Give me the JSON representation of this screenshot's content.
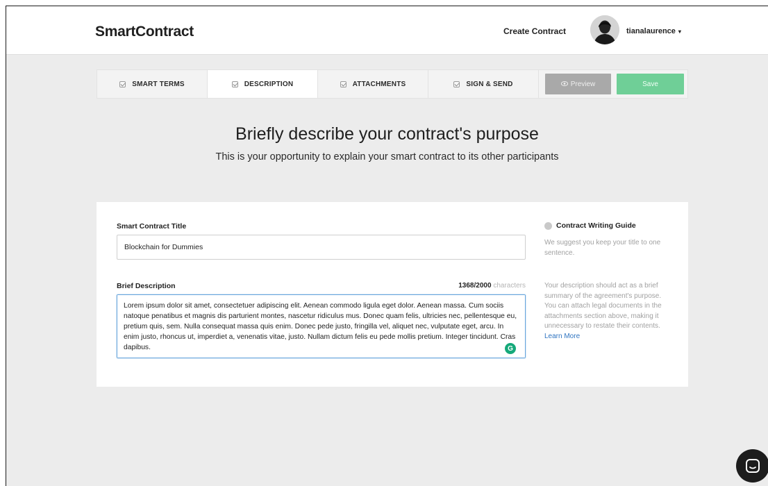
{
  "app": {
    "brand": "SmartContract",
    "create_contract": "Create Contract",
    "username": "tianalaurence",
    "caret": "▾"
  },
  "tabs": [
    {
      "label": "SMART TERMS",
      "active": false
    },
    {
      "label": "DESCRIPTION",
      "active": true
    },
    {
      "label": "ATTACHMENTS",
      "active": false
    },
    {
      "label": "SIGN & SEND",
      "active": false
    }
  ],
  "actions": {
    "preview_label": "Preview",
    "save_label": "Save"
  },
  "page": {
    "heading": "Briefly describe your contract's purpose",
    "subheading": "This is your opportunity to explain your smart contract to its other participants"
  },
  "form": {
    "title_label": "Smart Contract Title",
    "title_value": "Blockchain for Dummies",
    "description_label": "Brief Description",
    "char_count": "1368",
    "char_limit": "/2000",
    "char_suffix": "characters",
    "description_value": "Lorem ipsum dolor sit amet, consectetuer adipiscing elit. Aenean commodo ligula eget dolor. Aenean massa. Cum sociis natoque penatibus et magnis dis parturient montes, nascetur ridiculus mus. Donec quam felis, ultricies nec, pellentesque eu, pretium quis, sem. Nulla consequat massa quis enim. Donec pede justo, fringilla vel, aliquet nec, vulputate eget, arcu. In enim justo, rhoncus ut, imperdiet a, venenatis vitae, justo. Nullam dictum felis eu pede mollis pretium. Integer tincidunt. Cras dapibus."
  },
  "guide": {
    "title": "Contract Writing Guide",
    "title_tip": "We suggest you keep your title to one sentence.",
    "description_tip": "Your description should act as a brief summary of the agreement's purpose. You can attach legal documents in the attachments section above, making it unnecessary to restate their contents.",
    "learn_more": "Learn More"
  },
  "icons": {
    "checkbox": "checkbox-icon",
    "eye": "eye-icon",
    "info": "info-icon",
    "grammarly": "grammarly-icon",
    "chat": "chat-icon"
  },
  "colors": {
    "save": "#6fcf97",
    "preview": "#a9a9a9",
    "link": "#2f74c0",
    "focus_border": "#6aa7dd"
  }
}
